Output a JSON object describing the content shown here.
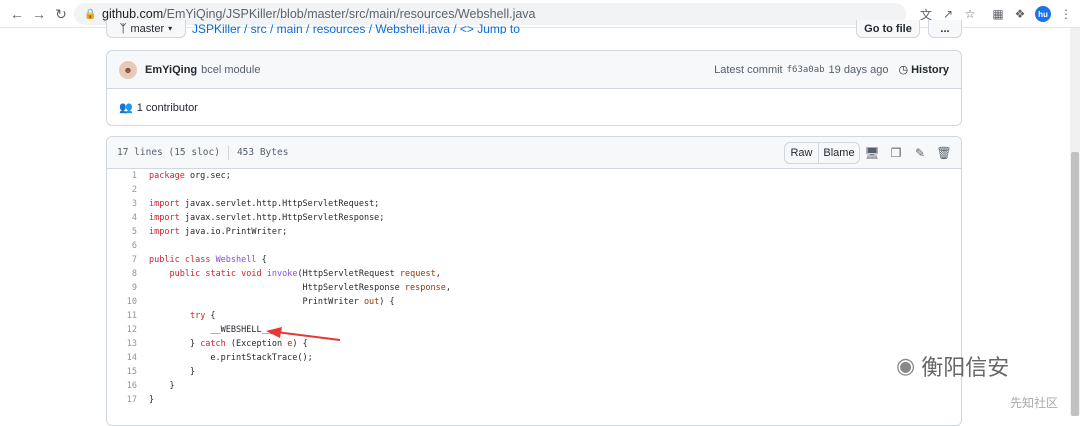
{
  "browser": {
    "url_main": "github.com",
    "url_path": "/EmYiQing/JSPKiller/blob/master/src/main/resources/Webshell.java",
    "profile": "hu"
  },
  "repo": {
    "branch": "master",
    "breadcrumb": "JSPKiller / src / main / resources / Webshell.java / <> Jump to",
    "go_to_file": "Go to file",
    "more": "..."
  },
  "commit": {
    "author": "EmYiQing",
    "message": "bcel module",
    "latest_label": "Latest commit",
    "hash": "f63a0ab",
    "age": "19 days ago",
    "history": "History",
    "contributors": "1 contributor"
  },
  "file": {
    "lines_info": "17 lines (15 sloc)",
    "size": "453 Bytes",
    "raw": "Raw",
    "blame": "Blame"
  },
  "code_lines": [
    {
      "n": "1",
      "t": "package org.sec;"
    },
    {
      "n": "2",
      "t": ""
    },
    {
      "n": "3",
      "t": "import javax.servlet.http.HttpServletRequest;"
    },
    {
      "n": "4",
      "t": "import javax.servlet.http.HttpServletResponse;"
    },
    {
      "n": "5",
      "t": "import java.io.PrintWriter;"
    },
    {
      "n": "6",
      "t": ""
    },
    {
      "n": "7",
      "t": "public class Webshell {"
    },
    {
      "n": "8",
      "t": "    public static void invoke(HttpServletRequest request,"
    },
    {
      "n": "9",
      "t": "                              HttpServletResponse response,"
    },
    {
      "n": "10",
      "t": "                              PrintWriter out) {"
    },
    {
      "n": "11",
      "t": "        try {"
    },
    {
      "n": "12",
      "t": "            __WEBSHELL__"
    },
    {
      "n": "13",
      "t": "        } catch (Exception e) {"
    },
    {
      "n": "14",
      "t": "            e.printStackTrace();"
    },
    {
      "n": "15",
      "t": "        }"
    },
    {
      "n": "16",
      "t": "    }"
    },
    {
      "n": "17",
      "t": "}"
    }
  ],
  "watermark": {
    "text": "衡阳信安",
    "sub": "先知社区"
  },
  "colors": {
    "arrow": "#e53935",
    "link": "#0969da"
  }
}
